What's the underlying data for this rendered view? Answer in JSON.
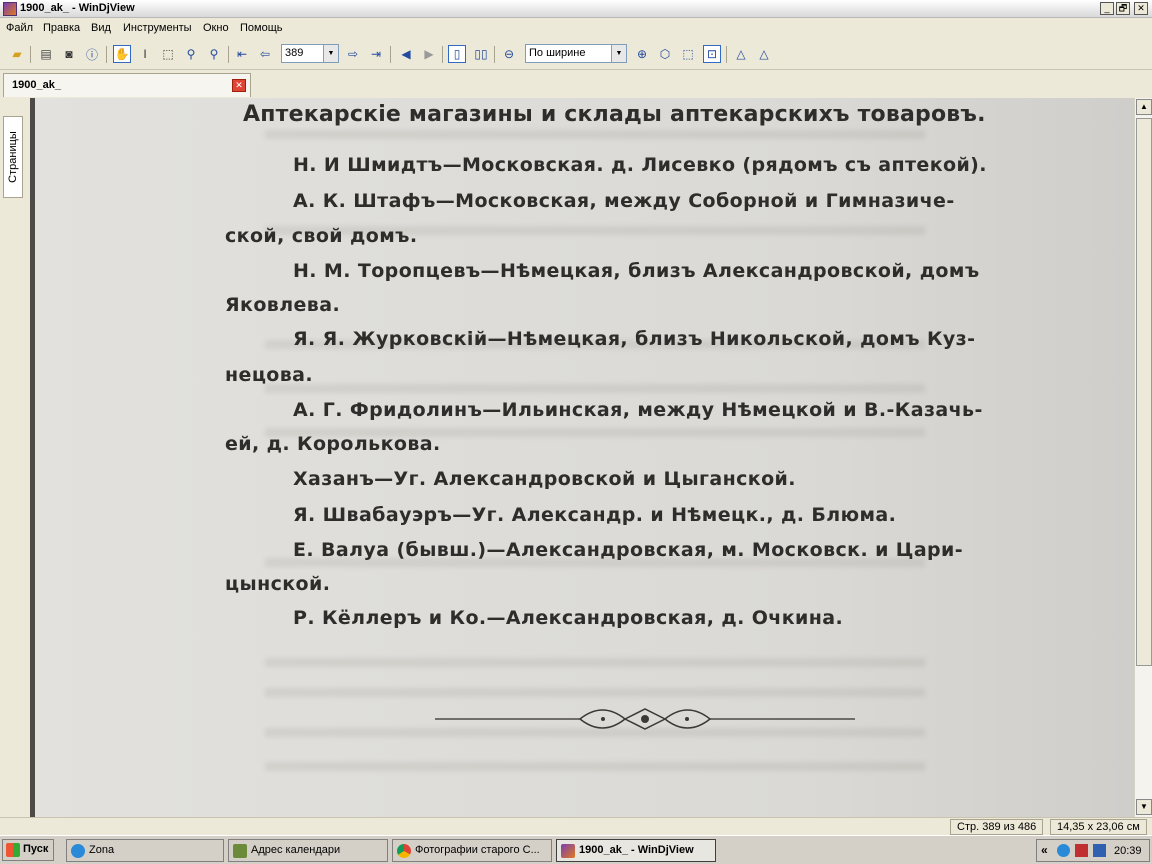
{
  "window": {
    "title": "1900_ak_ - WinDjView",
    "minimize": "_",
    "maximize": "🗗",
    "close": "✕"
  },
  "menu": [
    "Файл",
    "Правка",
    "Вид",
    "Инструменты",
    "Окно",
    "Помощь"
  ],
  "toolbar": {
    "page_number": "389",
    "zoom_mode": "По ширине"
  },
  "tab": {
    "label": "1900_ak_",
    "close": "✕"
  },
  "sidebar": {
    "pages_tab": "Страницы"
  },
  "document": {
    "heading": "Аптекарскiе магазины и склады аптекарскихъ товаровъ.",
    "lines": [
      "Н. И Шмидтъ—Московская. д. Лисевко (рядомъ съ аптекой).",
      "А. К. Штафъ—Московская, между Соборной и Гимназиче-",
      "ской, свой домъ.",
      "Н. М. Торопцевъ—Нѣмецкая, близъ Александровской, домъ",
      "Яковлева.",
      "Я. Я. Журковскiй—Нѣмецкая, близъ Никольской, домъ Куз-",
      "нецова.",
      "А. Г. Фридолинъ—Ильинская, между Нѣмецкой и В.-Казачь-",
      "ей, д. Королькова.",
      "Хазанъ—Уг. Александровской и Цыганской.",
      "Я. Швабауэръ—Уг. Александр. и Нѣмецк., д. Блюма.",
      "Е. Валуа (бывш.)—Александровская, м. Московск. и Цари-",
      "цынской.",
      "Р. Кёллеръ и Ко.—Александровская, д. Очкина."
    ]
  },
  "status": {
    "page_info": "Стр. 389 из 486",
    "page_size": "14,35 x 23,06 см"
  },
  "taskbar": {
    "start": "Пуск",
    "tasks": [
      "Zona",
      "Адрес календари",
      "Фотографии старого С...",
      "1900_ak_ - WinDjView"
    ],
    "tray_chevron": "«",
    "clock": "20:39"
  },
  "colors": {
    "title_gradient_top": "#ffffff",
    "chrome": "#ece9d8",
    "page_bg": "#dcdbd7",
    "ink": "#2e2d2b",
    "viewer_bg": "#4b4a48"
  },
  "icons": {
    "toolbar": [
      "open-folder-icon",
      "print-icon",
      "find-icon",
      "info-icon",
      "hand-tool-icon",
      "text-select-icon",
      "rect-select-icon",
      "zoom-in-tool-icon",
      "zoom-out-tool-icon",
      "first-page-icon",
      "prev-page-icon",
      "next-page-icon",
      "last-page-icon",
      "back-icon",
      "forward-icon",
      "single-page-icon",
      "facing-pages-icon",
      "zoom-out-icon",
      "zoom-in-icon",
      "fit-page-icon",
      "fit-width-icon",
      "actual-size-icon",
      "rotate-left-icon",
      "rotate-right-icon"
    ]
  }
}
